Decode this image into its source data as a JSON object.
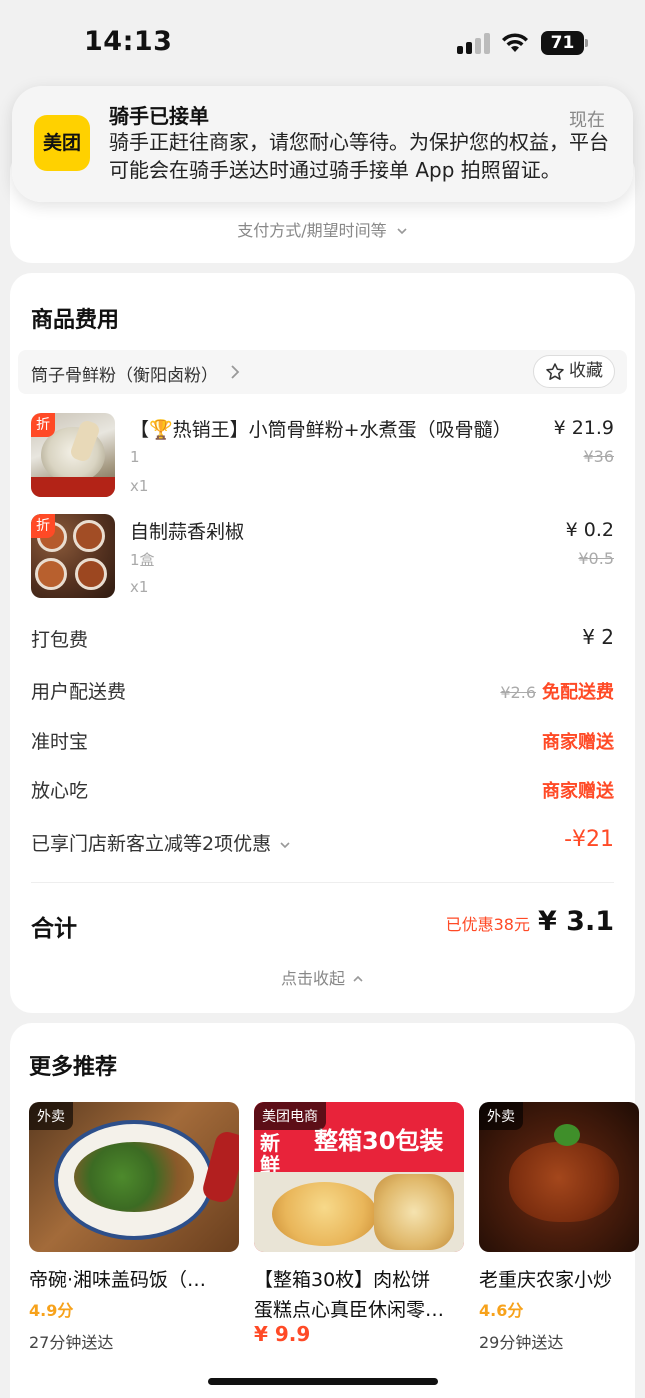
{
  "status_bar": {
    "time": "14:13",
    "battery": "71"
  },
  "notification": {
    "app": "美团",
    "title": "骑手已接单",
    "time": "现在",
    "body": "骑手正赶往商家，请您耐心等待。为保护您的权益，平台可能会在骑手送达时通过骑手接单 App 拍照留证。"
  },
  "top_card": {
    "pay_link": "支付方式/期望时间等"
  },
  "fees_section": {
    "title": "商品费用",
    "store": {
      "name": "筒子骨鲜粉（衡阳卤粉）",
      "fav_label": "收藏"
    },
    "items": [
      {
        "badge": "折",
        "name": "【🏆热销王】小筒骨鲜粉+水煮蛋（吸骨髓）",
        "spec": "1",
        "qty": "x1",
        "price": "¥ 21.9",
        "orig": "¥36"
      },
      {
        "badge": "折",
        "name": "自制蒜香剁椒",
        "spec": "1盒",
        "qty": "x1",
        "price": "¥ 0.2",
        "orig": "¥0.5"
      }
    ],
    "packing": {
      "label": "打包费",
      "value": "¥ 2"
    },
    "delivery": {
      "label": "用户配送费",
      "orig": "¥2.6",
      "value": "免配送费"
    },
    "ontime": {
      "label": "准时宝",
      "value": "商家赠送"
    },
    "safe": {
      "label": "放心吃",
      "value": "商家赠送"
    },
    "discount": {
      "label": "已享门店新客立减等2项优惠",
      "value": "-¥21"
    },
    "total": {
      "label": "合计",
      "saved": "已优惠38元",
      "value": "¥ 3.1"
    },
    "collapse": "点击收起"
  },
  "recommend": {
    "title": "更多推荐",
    "items": [
      {
        "tag": "外卖",
        "name": "帝碗·湘味盖码饭（…",
        "rating": "4.9分",
        "time": "27分钟送达"
      },
      {
        "tag": "美团电商",
        "name": "【整箱30枚】肉松饼",
        "name2": "蛋糕点心真臣休闲零…",
        "price": "¥ 9.9"
      },
      {
        "tag": "外卖",
        "name": "老重庆农家小炒",
        "rating": "4.6分",
        "time": "29分钟送达"
      }
    ]
  },
  "colors": {
    "accent_red": "#ff4a26",
    "rating_orange": "#f7a21b",
    "meituan_yellow": "#ffd100"
  }
}
